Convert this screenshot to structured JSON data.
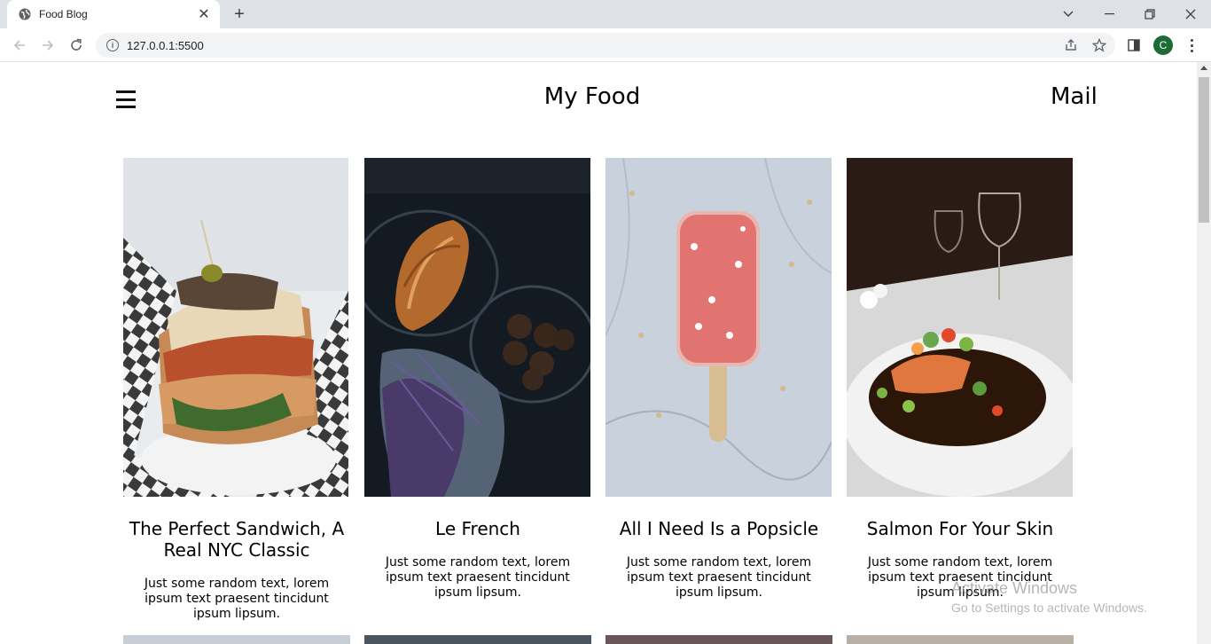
{
  "browser": {
    "tab_title": "Food Blog",
    "new_tab": "+",
    "url": "127.0.0.1:5500",
    "profile_initial": "C"
  },
  "site": {
    "title": "My Food",
    "mail": "Mail"
  },
  "posts": [
    {
      "title": "The Perfect Sandwich, A Real NYC Classic",
      "text": "Just some random text, lorem ipsum text praesent tincidunt ipsum lipsum.",
      "image": "sandwich"
    },
    {
      "title": "Le French",
      "text": "Just some random text, lorem ipsum text praesent tincidunt ipsum lipsum.",
      "image": "croissant"
    },
    {
      "title": "All I Need Is a Popsicle",
      "text": "Just some random text, lorem ipsum text praesent tincidunt ipsum lipsum.",
      "image": "popsicle"
    },
    {
      "title": "Salmon For Your Skin",
      "text": "Just some random text, lorem ipsum text praesent tincidunt ipsum lipsum.",
      "image": "salmon"
    }
  ],
  "watermark": {
    "title": "Activate Windows",
    "subtitle": "Go to Settings to activate Windows."
  }
}
